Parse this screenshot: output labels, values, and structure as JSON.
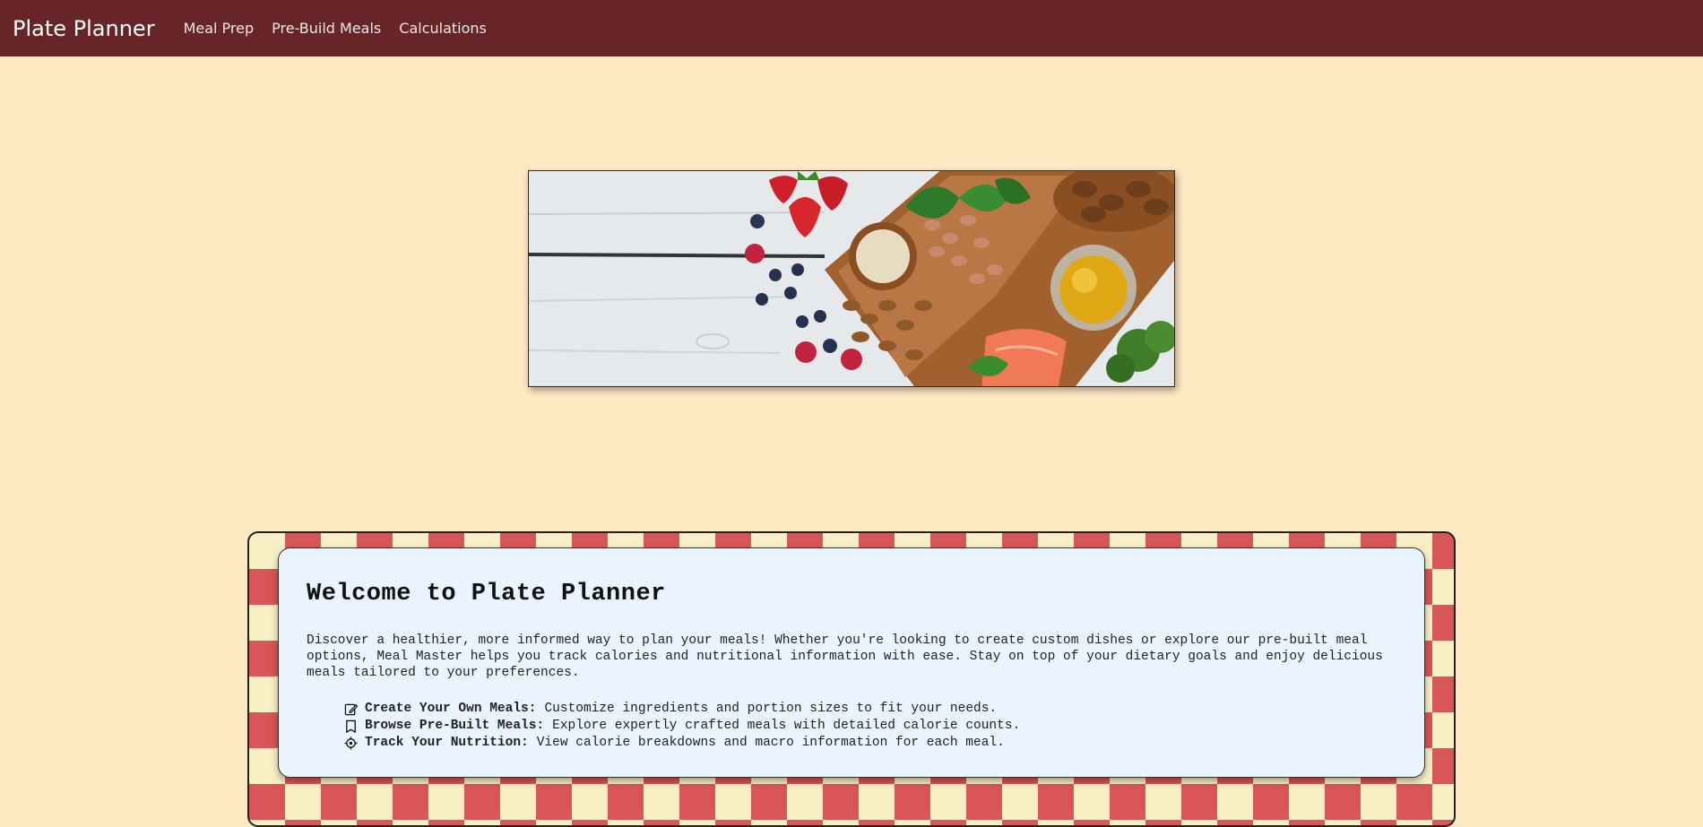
{
  "navbar": {
    "brand": "Plate Planner",
    "links": [
      {
        "label": "Meal Prep"
      },
      {
        "label": "Pre-Build Meals"
      },
      {
        "label": "Calculations"
      }
    ]
  },
  "hero": {
    "image_icon": "healthy-food-banner-image"
  },
  "welcome": {
    "title": "Welcome to Plate Planner",
    "intro": "Discover a healthier, more informed way to plan your meals! Whether you're looking to create custom dishes or explore our pre-built meal options, Meal Master helps you track calories and nutritional information with ease. Stay on top of your dietary goals and enjoy delicious meals tailored to your preferences.",
    "features": [
      {
        "icon": "edit-icon",
        "title": "Create Your Own Meals:",
        "text": "Customize ingredients and portion sizes to fit your needs."
      },
      {
        "icon": "bookmark-icon",
        "title": "Browse Pre-Built Meals:",
        "text": "Explore expertly crafted meals with detailed calorie counts."
      },
      {
        "icon": "target-icon",
        "title": "Track Your Nutrition:",
        "text": "View calorie breakdowns and macro information for each meal."
      }
    ]
  },
  "colors": {
    "navbar": "#672528",
    "background": "#ffe9c3",
    "card": "#eaf4fe",
    "checker_red": "#d85558",
    "checker_cream": "#f8f0c4"
  }
}
